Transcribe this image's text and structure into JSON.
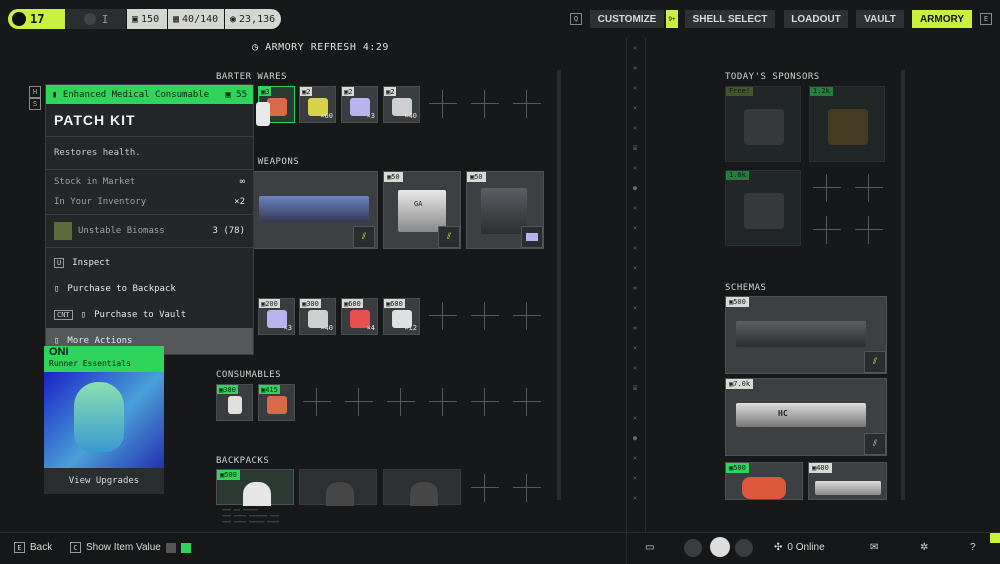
{
  "topbar": {
    "level": "17",
    "faction": "I",
    "currency": {
      "c1": "150",
      "c2": "40/140",
      "c3": "23,136"
    },
    "nav_key": "Q",
    "nav": [
      "CUSTOMIZE",
      "SHELL SELECT",
      "LOADOUT",
      "VAULT",
      "ARMORY"
    ],
    "notify_badge": "9+",
    "end_key": "E"
  },
  "refresh": {
    "label": "ARMORY REFRESH 4:29"
  },
  "keys_left": [
    "H",
    "S"
  ],
  "sections": {
    "barter": "BARTER WARES",
    "weapons": "RD WEAPONS",
    "consumables": "CONSUMABLES",
    "backpacks": "BACKPACKS",
    "sponsors": "TODAY'S SPONSORS",
    "schemas": "SCHEMAS"
  },
  "barter_items": [
    {
      "price": "3",
      "qty": ""
    },
    {
      "price": "2",
      "qty": "×60"
    },
    {
      "price": "2",
      "qty": "×3"
    },
    {
      "price": "2",
      "qty": "×40"
    }
  ],
  "weapons": [
    {
      "price": ""
    },
    {
      "price": "50",
      "badge": "GA"
    },
    {
      "price": "50"
    }
  ],
  "ammo_items": [
    {
      "price": "200",
      "qty": "×3"
    },
    {
      "price": "300",
      "qty": "×40"
    },
    {
      "price": "600",
      "qty": "×4"
    },
    {
      "price": "600",
      "qty": "×12"
    }
  ],
  "consumables": [
    {
      "price": "300"
    },
    {
      "price": "415"
    }
  ],
  "backpacks": [
    {
      "price": "500"
    }
  ],
  "tooltip": {
    "category": "Enhanced Medical Consumable",
    "price": "55",
    "title": "PATCH KIT",
    "description": "Restores health.",
    "stock_label": "Stock in Market",
    "stock_value": "∞",
    "inv_label": "In Your Inventory",
    "inv_value": "×2",
    "cost_label": "Unstable Biomass",
    "cost_value": "3 (78)",
    "actions": [
      {
        "key": "U",
        "label": "Inspect"
      },
      {
        "key": "",
        "label": "Purchase to Backpack"
      },
      {
        "key": "CNT",
        "label": "Purchase to Vault"
      },
      {
        "key": "",
        "label": "More Actions"
      }
    ]
  },
  "left_card": {
    "brand": "ONI",
    "subtitle": "Runner Essentials",
    "button": "View Upgrades"
  },
  "sponsors": [
    {
      "label": "Free!"
    },
    {
      "label": "1.2k"
    },
    {
      "label": "1.0k"
    }
  ],
  "schemas": [
    {
      "price": "500",
      "badge": ""
    },
    {
      "price": "7.0k",
      "badge": "HC"
    },
    {
      "price": "500",
      "badge": ""
    },
    {
      "price": "400",
      "badge": ""
    }
  ],
  "bottombar": {
    "back_key": "E",
    "back": "Back",
    "show_key": "C",
    "show_value": "Show Item Value",
    "online": "0 Online"
  },
  "colors": {
    "accent": "#c8f03c",
    "green": "#2fd45a",
    "bg": "#16181a"
  }
}
